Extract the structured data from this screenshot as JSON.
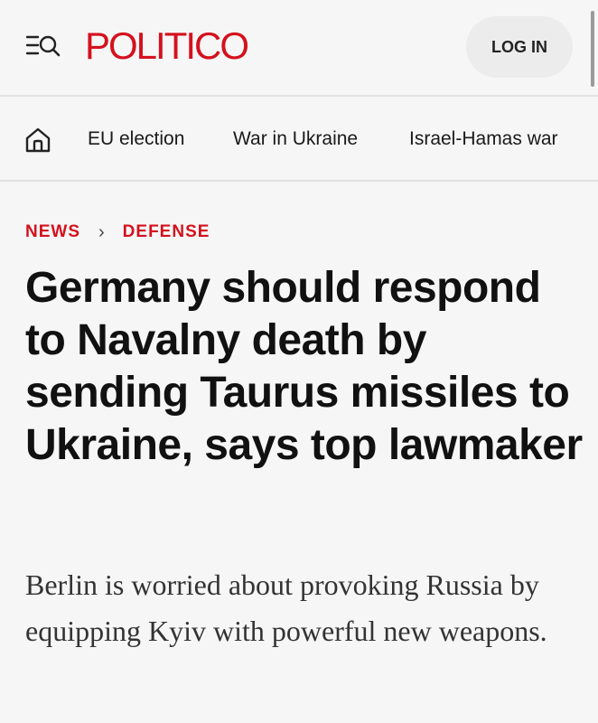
{
  "header": {
    "logo_text": "POLITICO",
    "login_label": "LOG IN",
    "menu_icon": "menu-search-icon"
  },
  "nav": {
    "home_icon": "home-icon",
    "links": [
      {
        "label": "EU election"
      },
      {
        "label": "War in Ukraine"
      },
      {
        "label": "Israel-Hamas war"
      }
    ]
  },
  "breadcrumb": {
    "section": "NEWS",
    "separator": "›",
    "subsection": "DEFENSE"
  },
  "article": {
    "headline": "Germany should respond to Navalny death by sending Taurus missiles to Ukraine, says top lawmaker",
    "dek": "Berlin is worried about provoking Russia by equipping Kyiv with powerful new weapons."
  },
  "colors": {
    "brand_red": "#d4111e",
    "background": "#f6f6f6",
    "text": "#111111"
  }
}
